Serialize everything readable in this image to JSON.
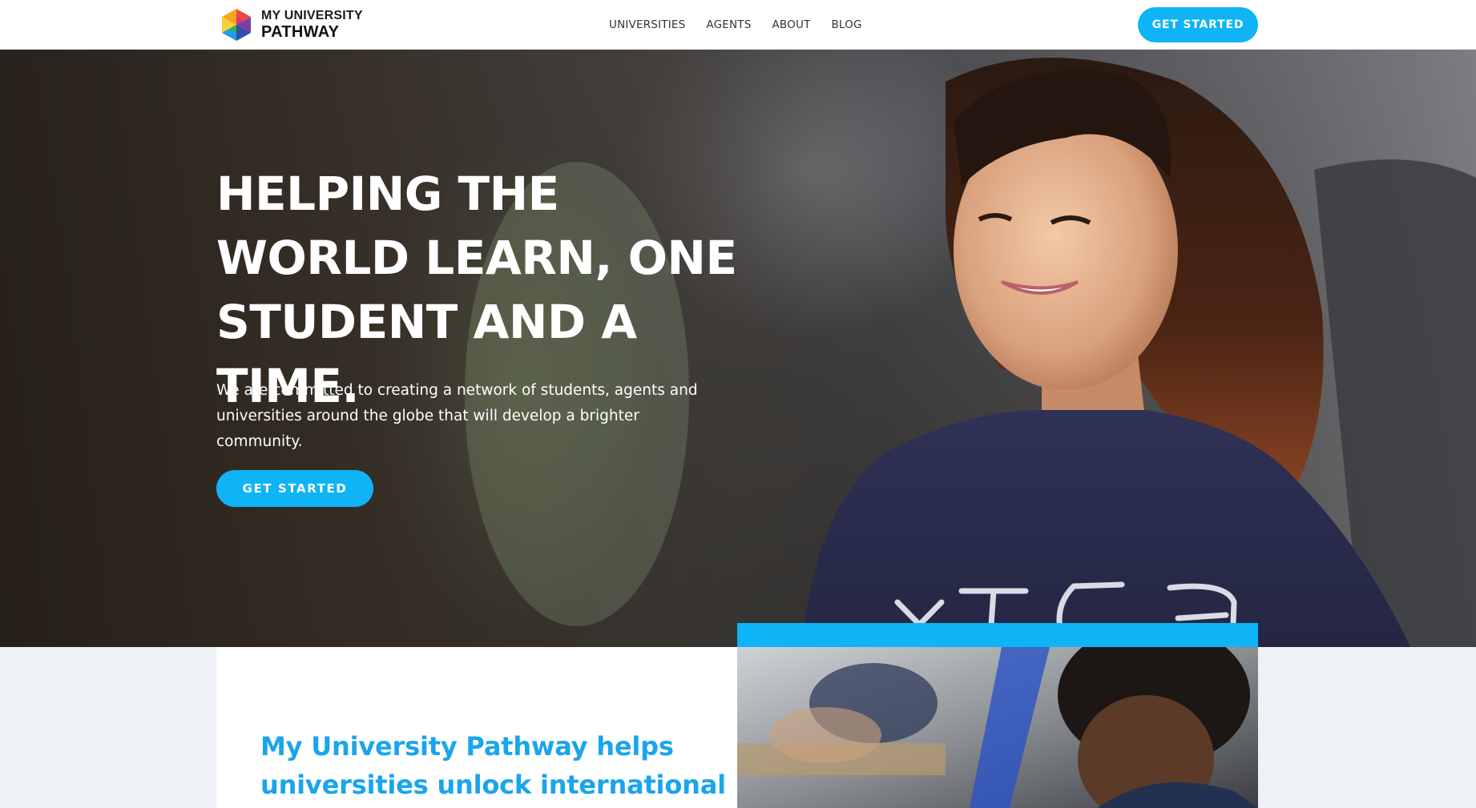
{
  "header": {
    "logo": {
      "line1": "MY UNIVERSITY",
      "line2": "PATHWAY"
    },
    "nav": [
      {
        "label": "UNIVERSITIES"
      },
      {
        "label": "AGENTS"
      },
      {
        "label": "ABOUT"
      },
      {
        "label": "BLOG"
      }
    ],
    "cta_label": "GET STARTED"
  },
  "hero": {
    "title": "HELPING THE WORLD LEARN, ONE STUDENT AND A TIME.",
    "subtitle": "We are committed to creating a network of students, agents and universities around the globe that will develop a brighter community.",
    "cta_label": "GET STARTED"
  },
  "section": {
    "title": "My University Pathway helps universities unlock international"
  },
  "colors": {
    "accent": "#0eb4f5",
    "section_title": "#1aa5ec",
    "background": "#eef1f6"
  }
}
